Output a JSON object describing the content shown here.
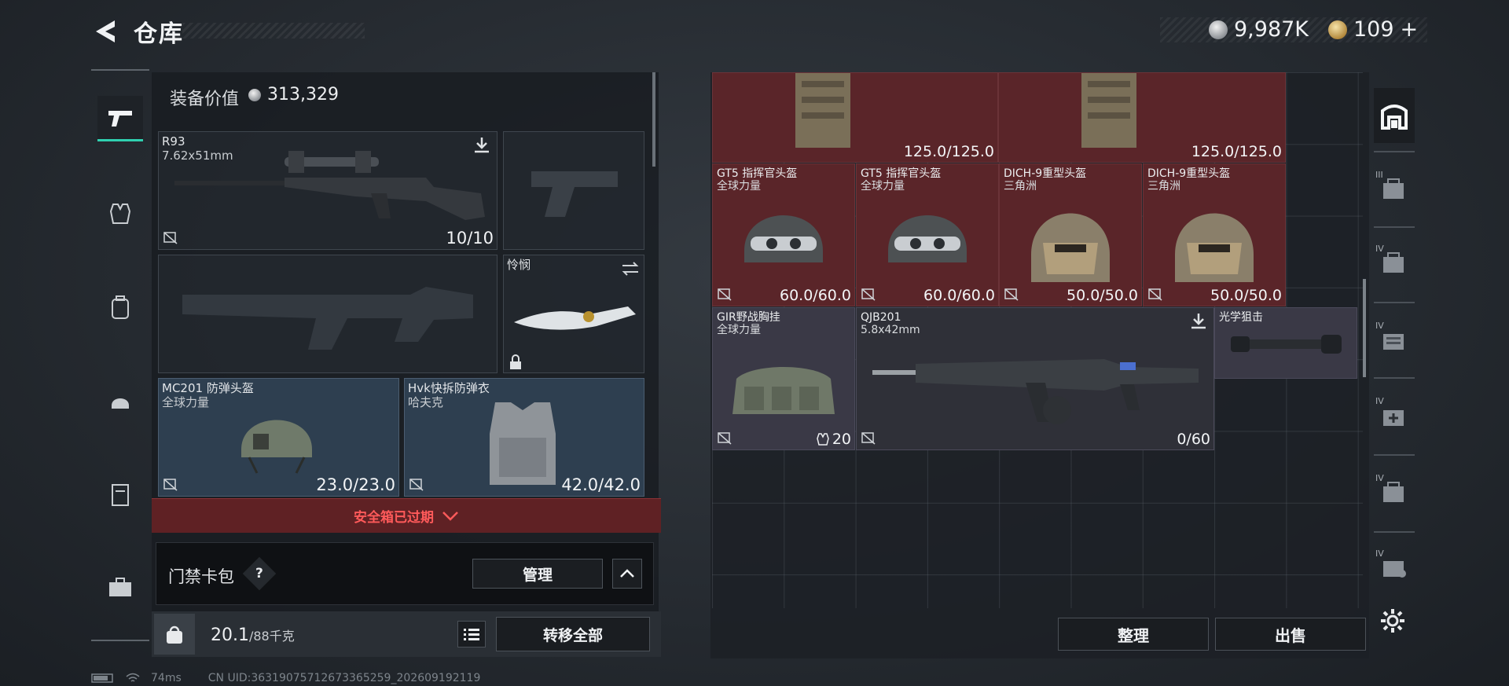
{
  "header": {
    "title": "仓库",
    "silver_amount": "9,987K",
    "gold_amount": "109",
    "gold_add": "+"
  },
  "left_rail": {
    "items": [
      "pistol-icon",
      "vest-icon",
      "backpack-icon",
      "helmet-icon",
      "case-icon",
      "briefcase-icon"
    ]
  },
  "loadout": {
    "equip_value_label": "装备价值",
    "equip_value": "313,329",
    "primary": {
      "name": "R93",
      "caliber": "7.62x51mm",
      "ammo": "10/10"
    },
    "melee": {
      "name": "怜悯"
    },
    "helmet": {
      "name": "MC201 防弹头盔",
      "faction": "全球力量",
      "durability": "23.0/23.0"
    },
    "armor": {
      "name": "Hvk快拆防弹衣",
      "faction": "哈夫克",
      "durability": "42.0/42.0"
    },
    "expired_text": "安全箱已过期",
    "card_pack_label": "门禁卡包",
    "help": "?",
    "manage": "管理",
    "weight_current": "20.1",
    "weight_max": "/88千克",
    "transfer_all": "转移全部"
  },
  "status": {
    "latency": "74ms",
    "uid": "CN UID:3631907571267336525­9_202609192119"
  },
  "storage": {
    "top_row": [
      {
        "value": "125.0/125.0"
      },
      {
        "value": "125.0/125.0"
      }
    ],
    "helmets": [
      {
        "name": "GT5 指挥官头盔",
        "faction": "全球力量",
        "value": "60.0/60.0"
      },
      {
        "name": "GT5 指挥官头盔",
        "faction": "全球力量",
        "value": "60.0/60.0"
      },
      {
        "name": "DICH-9重型头盔",
        "faction": "三角洲",
        "value": "50.0/50.0"
      },
      {
        "name": "DICH-9重型头盔",
        "faction": "三角洲",
        "value": "50.0/50.0"
      }
    ],
    "rig": {
      "name": "GIR野战胸挂",
      "faction": "全球力量",
      "capacity": "20"
    },
    "rifle": {
      "name": "QJB201",
      "caliber": "5.8x42mm",
      "ammo": "0/60"
    },
    "scope": {
      "name": "光学狙击"
    },
    "sort": "整理",
    "sell": "出售"
  },
  "right_tabs": [
    {
      "label": "",
      "icon": "storage-icon"
    },
    {
      "label": "III",
      "icon": "case-iii-icon"
    },
    {
      "label": "IV",
      "icon": "case-iv-icon"
    },
    {
      "label": "IV",
      "icon": "case-iv-icon"
    },
    {
      "label": "IV",
      "icon": "case-iv-icon"
    },
    {
      "label": "IV",
      "icon": "case-iv-icon"
    },
    {
      "label": "IV",
      "icon": "case-iv-icon"
    }
  ]
}
